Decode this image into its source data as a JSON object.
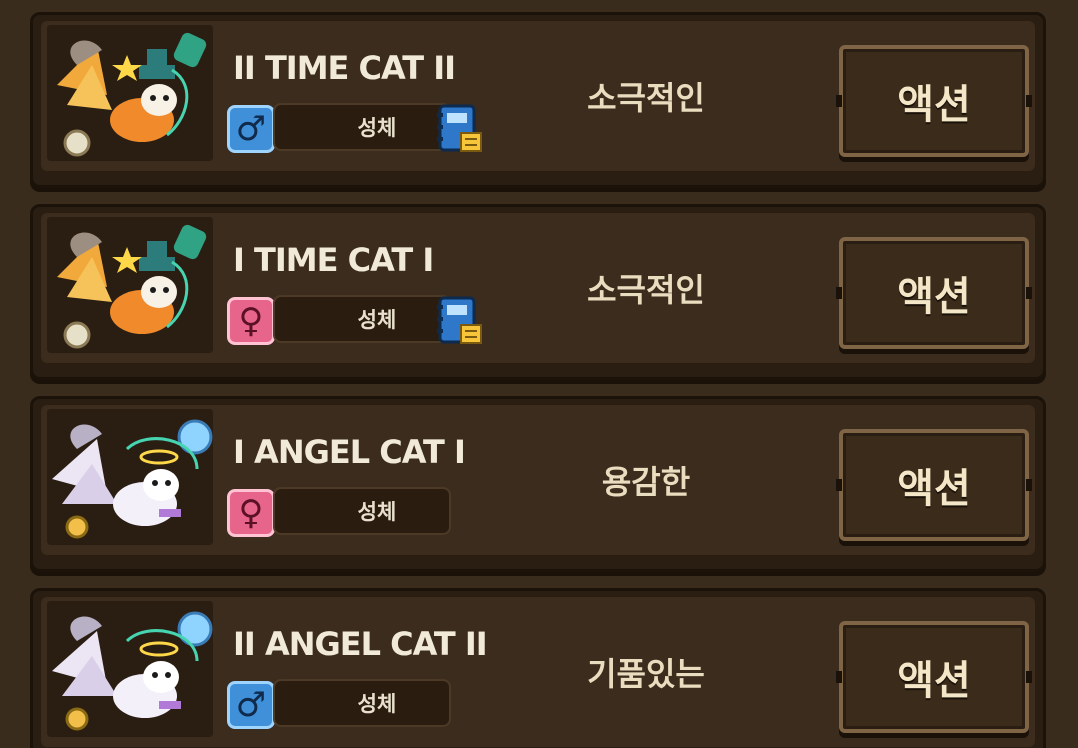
{
  "cats": [
    {
      "name": "II TIME CAT II",
      "gender": "male",
      "gender_symbol": "♂",
      "stat_label": "성체",
      "has_book": true,
      "personality": "소극적인",
      "action_label": "액션",
      "portrait": "time-cat"
    },
    {
      "name": "I TIME CAT I",
      "gender": "female",
      "gender_symbol": "♀",
      "stat_label": "성체",
      "has_book": true,
      "personality": "소극적인",
      "action_label": "액션",
      "portrait": "time-cat"
    },
    {
      "name": "I ANGEL CAT I",
      "gender": "female",
      "gender_symbol": "♀",
      "stat_label": "성체",
      "has_book": false,
      "personality": "용감한",
      "action_label": "액션",
      "portrait": "angel-cat"
    },
    {
      "name": "II ANGEL CAT II",
      "gender": "male",
      "gender_symbol": "♂",
      "stat_label": "성체",
      "has_book": false,
      "personality": "기품있는",
      "action_label": "액션",
      "portrait": "angel-cat"
    }
  ],
  "colors": {
    "background": "#3a2c1c",
    "card": "#3b2c1d",
    "male": "#3f8fd9",
    "female": "#e7648a",
    "text": "#f2ead8"
  }
}
